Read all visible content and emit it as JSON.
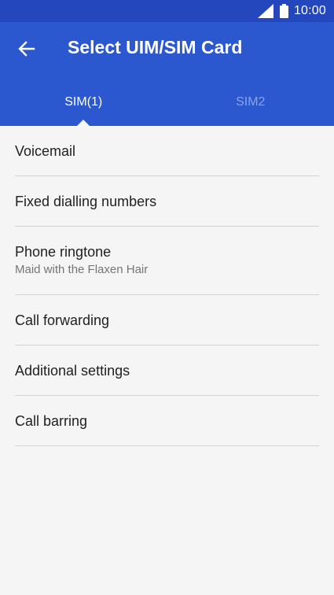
{
  "status_bar": {
    "time": "10:00",
    "icons": [
      "signal-icon",
      "battery-icon"
    ]
  },
  "header": {
    "title": "Select UIM/SIM Card",
    "back_icon": "arrow-left-icon"
  },
  "tabs": [
    {
      "label": "SIM(1)",
      "active": true
    },
    {
      "label": "SIM2",
      "active": false
    }
  ],
  "settings": [
    {
      "title": "Voicemail"
    },
    {
      "title": "Fixed dialling numbers"
    },
    {
      "title": "Phone ringtone",
      "subtitle": "Maid with the Flaxen Hair"
    },
    {
      "title": "Call forwarding"
    },
    {
      "title": "Additional settings"
    },
    {
      "title": "Call barring"
    }
  ],
  "colors": {
    "status_bar": "#2447bd",
    "app_bar": "#2b57cf",
    "background": "#f5f5f5",
    "inactive_tab": "#8aa3e8",
    "divider": "#d2d2d2"
  }
}
